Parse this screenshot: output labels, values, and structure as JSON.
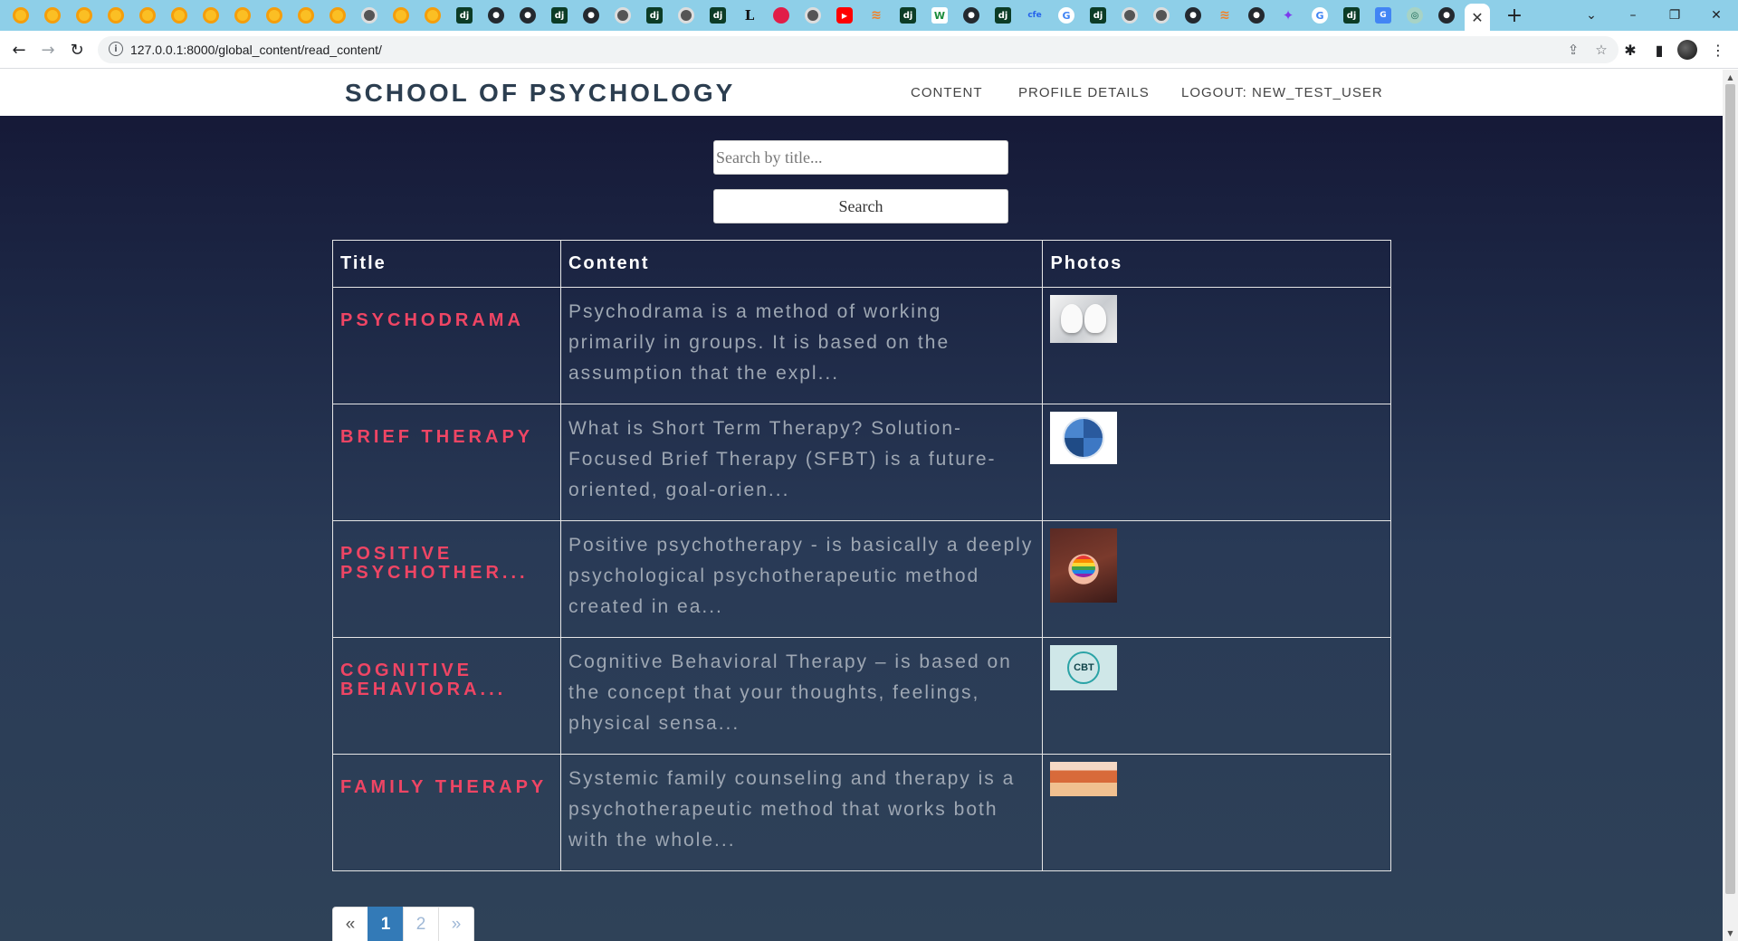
{
  "browser": {
    "url": "127.0.0.1:8000/global_content/read_content/",
    "active_tab_close": "✕",
    "new_tab": "+",
    "window_controls": {
      "tab_search": "⌄",
      "minimize": "–",
      "restore": "❐",
      "close": "✕"
    }
  },
  "site": {
    "brand": "SCHOOL OF PSYCHOLOGY",
    "nav": {
      "content": "CONTENT",
      "profile": "PROFILE DETAILS",
      "logout": "LOGOUT: NEW_TEST_USER"
    }
  },
  "search": {
    "placeholder": "Search by title...",
    "button": "Search"
  },
  "table": {
    "headers": {
      "title": "Title",
      "content": "Content",
      "photos": "Photos"
    },
    "rows": [
      {
        "title": "PSYCHODRAMA",
        "content": "Psychodrama is a method of working primarily in groups. It is based on the assumption that the expl...",
        "photo": "psychodrama-thumbnail"
      },
      {
        "title": "BRIEF THERAPY",
        "content": "What is Short Term Therapy? Solution-Focused Brief Therapy (SFBT) is a future-oriented, goal-orien...",
        "photo": "brief-therapy-thumbnail"
      },
      {
        "title": "POSITIVE PSYCHOTHER...",
        "content": "Positive psychotherapy - is basically a deeply psychological psychotherapeutic method created in ea...",
        "photo": "positive-psychotherapy-thumbnail"
      },
      {
        "title": "COGNITIVE BEHAVIORA...",
        "content": "Cognitive Behavioral Therapy – is based on the concept that your thoughts, feelings, physical sensa...",
        "photo": "cbt-thumbnail",
        "photo_text": "CBT"
      },
      {
        "title": "FAMILY THERAPY",
        "content": "Systemic family counseling and therapy is a psychotherapeutic method that works both with the whole...",
        "photo": "family-therapy-thumbnail"
      }
    ]
  },
  "pagination": {
    "prev": "«",
    "page1": "1",
    "page2": "2",
    "next": "»",
    "current": 1
  }
}
